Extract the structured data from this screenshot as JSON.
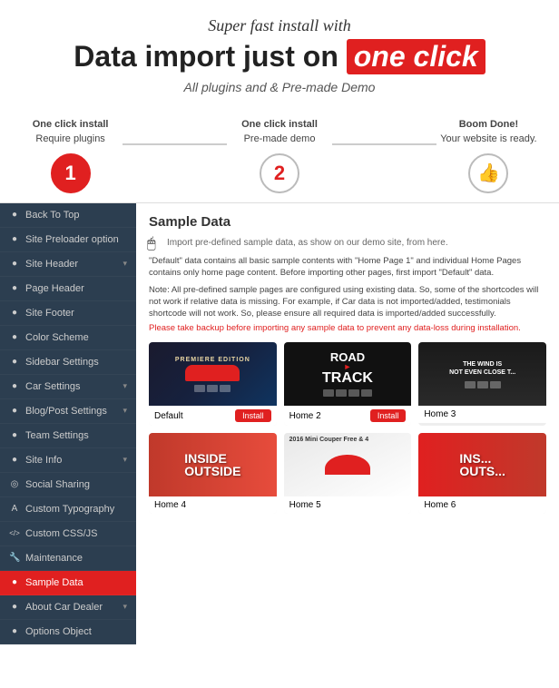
{
  "header": {
    "subtitle": "Super fast install with",
    "main_title_start": "Data import just on",
    "main_title_highlight": "one click",
    "description": "All plugins and & Pre-made Demo"
  },
  "steps": [
    {
      "number": "1",
      "label_line1": "One click install",
      "label_line2": "Require plugins"
    },
    {
      "number": "2",
      "label_line1": "One click install",
      "label_line2": "Pre-made demo"
    },
    {
      "number": "👍",
      "label_line1": "Boom Done!",
      "label_line2": "Your website is ready."
    }
  ],
  "sidebar": {
    "items": [
      {
        "label": "Back To Top",
        "icon": "●",
        "has_arrow": false
      },
      {
        "label": "Site Preloader option",
        "icon": "●",
        "has_arrow": false
      },
      {
        "label": "Site Header",
        "icon": "●",
        "has_arrow": true
      },
      {
        "label": "Page Header",
        "icon": "●",
        "has_arrow": false
      },
      {
        "label": "Site Footer",
        "icon": "●",
        "has_arrow": false
      },
      {
        "label": "Color Scheme",
        "icon": "●",
        "has_arrow": false
      },
      {
        "label": "Sidebar Settings",
        "icon": "●",
        "has_arrow": false
      },
      {
        "label": "Car Settings",
        "icon": "●",
        "has_arrow": true
      },
      {
        "label": "Blog/Post Settings",
        "icon": "●",
        "has_arrow": true
      },
      {
        "label": "Team Settings",
        "icon": "●",
        "has_arrow": false
      },
      {
        "label": "Site Info",
        "icon": "●",
        "has_arrow": true
      },
      {
        "label": "Social Sharing",
        "icon": "●",
        "has_arrow": false
      },
      {
        "label": "Custom Typography",
        "icon": "●",
        "has_arrow": false
      },
      {
        "label": "Custom CSS/JS",
        "icon": "<>",
        "has_arrow": false
      },
      {
        "label": "Maintenance",
        "icon": "🔧",
        "has_arrow": false
      },
      {
        "label": "Sample Data",
        "icon": "●",
        "has_arrow": false,
        "active": true
      },
      {
        "label": "About Car Dealer",
        "icon": "●",
        "has_arrow": true
      },
      {
        "label": "Options Object",
        "icon": "●",
        "has_arrow": false
      }
    ]
  },
  "content": {
    "title": "Sample Data",
    "cursor_icon": "🖱",
    "description": "Import pre-defined sample data, as show on our demo site, from here.",
    "note": "\"Default\" data contains all basic sample contents with \"Home Page 1\" and individual Home Pages contains only home page content. Before importing other pages, first import \"Default\" data.",
    "note2": "Note: All pre-defined sample pages are configured using existing data. So, some of the shortcodes will not work if relative data is missing. For example, if Car data is not imported/added, testimonials shortcode will not work. So, please ensure all required data is imported/added successfully.",
    "warning": "Please take backup before importing any sample data to prevent any data-loss during installation.",
    "themes": [
      {
        "id": "default",
        "name": "Default",
        "install_label": "Install",
        "thumb_type": "default",
        "premiere_text": "PREMIERE EDITION"
      },
      {
        "id": "home2",
        "name": "Home 2",
        "install_label": "Install",
        "thumb_type": "road",
        "road_text": "ROAD > TRACK"
      },
      {
        "id": "home3",
        "name": "Home 3",
        "install_label": "",
        "thumb_type": "wind",
        "wind_text": "THE WIND IS\nNOT EVEN CLOSE T..."
      },
      {
        "id": "home4",
        "name": "Home 4",
        "install_label": "",
        "thumb_type": "inside",
        "inside_text": "INSIDE\nOUTSIDE"
      },
      {
        "id": "home5",
        "name": "Home 5",
        "install_label": "",
        "thumb_type": "mini",
        "mini_text": "2016 Mini Couper\nFree & 4"
      },
      {
        "id": "home6",
        "name": "Home 6",
        "install_label": "",
        "thumb_type": "home6",
        "home6_text": "INS...\nOUTS..."
      }
    ]
  },
  "colors": {
    "red": "#e02020",
    "dark_sidebar": "#2c3e50",
    "active_sidebar": "#e02020"
  }
}
